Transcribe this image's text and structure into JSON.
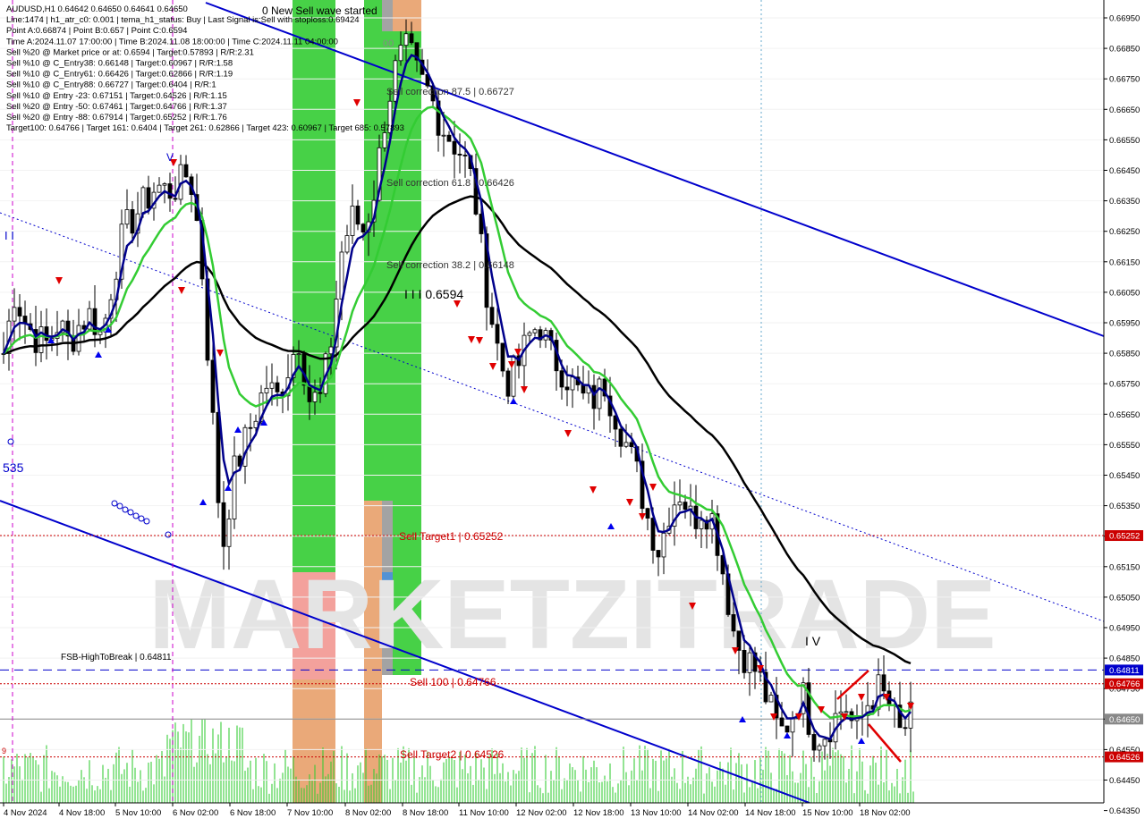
{
  "info_lines": [
    "AUDUSD,H1  0.64642 0.64650 0.64641 0.64650",
    "Line:1474  |  h1_atr_c0: 0.001  |  tema_h1_status: Buy  |  Last Signal is:Sell with stoploss:0.69424",
    "Point A:0.66874  |  Point B:0.657  |  Point C:0.6594",
    "Time A:2024.11.07 17:00:00  |  Time B:2024.11.08 18:00:00  |  Time C:2024.11.11 04:00:00",
    "Sell %20 @ Market price or at: 0.6594  |  Target:0.57893  |  R/R:2.31",
    "Sell %10 @ C_Entry38: 0.66148  |  Target:0.60967  |  R/R:1.58",
    "Sell %10 @ C_Entry61: 0.66426  |  Target:0.62866  |  R/R:1.19",
    "Sell %10 @ C_Entry88: 0.66727  |  Target:0.6404  |  R/R:1",
    "Sell %10 @ Entry -23: 0.67151  |  Target:0.64526  |  R/R:1.15",
    "Sell %20 @ Entry -50: 0.67461  |  Target:0.64766  |  R/R:1.37",
    "Sell %20 @ Entry -88: 0.67914  |  Target:0.65252  |  R/R:1.76",
    "Target100: 0.64766  |  Target 161: 0.6404  |  Target 261: 0.62866  |  Target 423: 0.60967  |  Target 685: 0.57893"
  ],
  "annotations": {
    "new_wave": "0 New Sell wave started",
    "sell_corr_875": "Sell correction 87.5 | 0.66727",
    "sell_corr_618": "Sell correction 61.8 | 0.66426",
    "sell_corr_382": "Sell correction 38.2 | 0.66148",
    "point_c": "I I I  0.6594",
    "sell_target1": "Sell Target1 | 0.65252",
    "sell_100": "Sell 100 | 0.64766",
    "sell_target2": "Sell Target2 | 0.64526",
    "fsb": "FSB-HighToBreak | 0.64811",
    "wave_ii": "I I",
    "wave_v": "V",
    "wave_iv": "I V",
    "left_num": "535",
    "small_00": "00",
    "small_9": "9",
    "watermark": "MARKETZITRADE"
  },
  "colors": {
    "background": "#ffffff",
    "candle": "#000000",
    "tema": "#00008b",
    "ma_green": "#33cc33",
    "ma_long": "#000000",
    "channel": "#0000cc",
    "target_red": "#cc0000",
    "fsb_blue": "#0000cc",
    "price_label": "#888888",
    "volume": "#33cc33",
    "green_zone": "#33cc33",
    "orange_zone": "#e8a06a",
    "pink_zone": "#f4a0a0",
    "gray_zone": "#999999"
  },
  "chart_data": {
    "type": "candlestick",
    "symbol": "AUDUSD",
    "timeframe": "H1",
    "ylim": [
      0.6435,
      0.67
    ],
    "y_ticks": [
      "0.66950",
      "0.66850",
      "0.66750",
      "0.66650",
      "0.66550",
      "0.66450",
      "0.66350",
      "0.66250",
      "0.66150",
      "0.66050",
      "0.65950",
      "0.65850",
      "0.65750",
      "0.65650",
      "0.65550",
      "0.65450",
      "0.65350",
      "0.65250",
      "0.65150",
      "0.65050",
      "0.64950",
      "0.64850",
      "0.64750",
      "0.64650",
      "0.64550",
      "0.64450",
      "0.64350"
    ],
    "x_ticks": [
      "4 Nov 2024",
      "4 Nov 18:00",
      "5 Nov 10:00",
      "6 Nov 02:00",
      "6 Nov 18:00",
      "7 Nov 10:00",
      "8 Nov 02:00",
      "8 Nov 18:00",
      "11 Nov 10:00",
      "12 Nov 02:00",
      "12 Nov 18:00",
      "13 Nov 10:00",
      "14 Nov 02:00",
      "14 Nov 18:00",
      "15 Nov 10:00",
      "18 Nov 02:00"
    ],
    "price_levels": [
      {
        "label": "0.65252",
        "value": 0.65252,
        "color": "#cc0000"
      },
      {
        "label": "0.64811",
        "value": 0.64811,
        "color": "#0000cc"
      },
      {
        "label": "0.64766",
        "value": 0.64766,
        "color": "#cc0000"
      },
      {
        "label": "0.64650",
        "value": 0.6465,
        "color": "#888888"
      },
      {
        "label": "0.64526",
        "value": 0.64526,
        "color": "#cc0000"
      }
    ],
    "close_path": [
      0.6585,
      0.6605,
      0.6595,
      0.659,
      0.6588,
      0.6595,
      0.6588,
      0.6595,
      0.6598,
      0.659,
      0.661,
      0.6625,
      0.663,
      0.6635,
      0.664,
      0.6638,
      0.664,
      0.6645,
      0.662,
      0.657,
      0.652,
      0.6545,
      0.6555,
      0.6565,
      0.6575,
      0.657,
      0.658,
      0.659,
      0.657,
      0.657,
      0.659,
      0.662,
      0.663,
      0.6625,
      0.664,
      0.6665,
      0.668,
      0.6685,
      0.6675,
      0.667,
      0.666,
      0.6655,
      0.665,
      0.664,
      0.661,
      0.659,
      0.6575,
      0.658,
      0.659,
      0.6595,
      0.6585,
      0.658,
      0.6575,
      0.657,
      0.657,
      0.6575,
      0.6565,
      0.6555,
      0.6545,
      0.653,
      0.652,
      0.6535,
      0.654,
      0.653,
      0.6535,
      0.653,
      0.651,
      0.649,
      0.6485,
      0.648,
      0.647,
      0.646,
      0.6465,
      0.6475,
      0.646,
      0.646,
      0.6465,
      0.647,
      0.646,
      0.647,
      0.6475,
      0.647,
      0.646,
      0.6465
    ]
  }
}
